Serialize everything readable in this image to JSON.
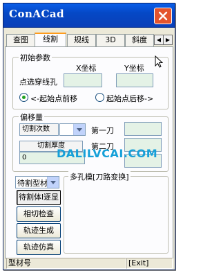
{
  "window": {
    "title": "ConACad"
  },
  "tabs": [
    {
      "label": "查图"
    },
    {
      "label": "线割"
    },
    {
      "label": "规线"
    },
    {
      "label": "3D"
    },
    {
      "label": "斜度"
    }
  ],
  "tab_scroll": {
    "left": "◀",
    "right": "▶"
  },
  "start_params": {
    "title": "初始参数",
    "x_label": "X坐标",
    "y_label": "Y坐标",
    "select_hole_label": "点选穿线孔",
    "x_value": "",
    "y_value": "",
    "radio_forward": "<-起始点前移",
    "radio_backward": "起始点后移->",
    "selected": "forward"
  },
  "offset": {
    "title": "偏移量",
    "cut_count_label": "切割次数",
    "cut_count_value": "",
    "cut1_label": "第一刀",
    "cut2_label": "第二刀",
    "thickness_label": "切割厚度",
    "thickness_value": "0",
    "cut3_label": "",
    "cut1_value": "",
    "cut2_value": "",
    "cut3_value": ""
  },
  "material_combo": {
    "value": "待割型材"
  },
  "buttons": {
    "cut_material": "待割体l逐显",
    "contour_check": "相切检查",
    "generate_path": "轨迹生成",
    "simulate_path": "轨迹仿真"
  },
  "multi_hole": {
    "title": "多孔模[刀路变换]"
  },
  "watermark": "DALILVCAI.COM",
  "status": {
    "left": "型材号",
    "right": "[Exit]"
  }
}
